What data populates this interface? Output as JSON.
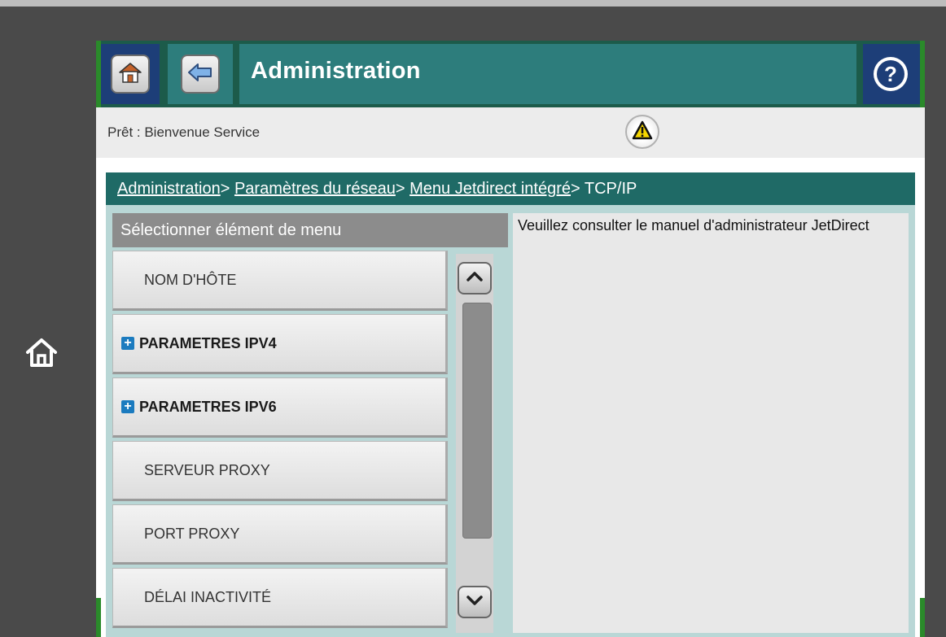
{
  "header": {
    "title": "Administration",
    "home_icon": "home-icon",
    "back_icon": "back-arrow-icon",
    "help_icon": "help-icon"
  },
  "status": {
    "text": "Prêt : Bienvenue Service",
    "warning_icon": "warning-icon"
  },
  "breadcrumb": {
    "items": [
      "Administration",
      "Paramètres du réseau",
      "Menu Jetdirect intégré"
    ],
    "separator": ">",
    "current": "TCP/IP"
  },
  "list": {
    "header": "Sélectionner élément de menu",
    "items": [
      {
        "label": "NOM D'HÔTE",
        "expandable": false
      },
      {
        "label": "PARAMETRES IPV4",
        "expandable": true
      },
      {
        "label": "PARAMETRES IPV6",
        "expandable": true
      },
      {
        "label": "SERVEUR PROXY",
        "expandable": false
      },
      {
        "label": "PORT PROXY",
        "expandable": false
      },
      {
        "label": "DÉLAI INACTIVITÉ",
        "expandable": false
      }
    ]
  },
  "info": {
    "text": "Veuillez consulter le manuel d'administrateur JetDirect"
  },
  "colors": {
    "header_bg": "#2d7d7c",
    "breadcrumb_bg": "#1f6a66",
    "panel_bg": "#b9d7d6",
    "accent_plus": "#1b7bbf"
  }
}
